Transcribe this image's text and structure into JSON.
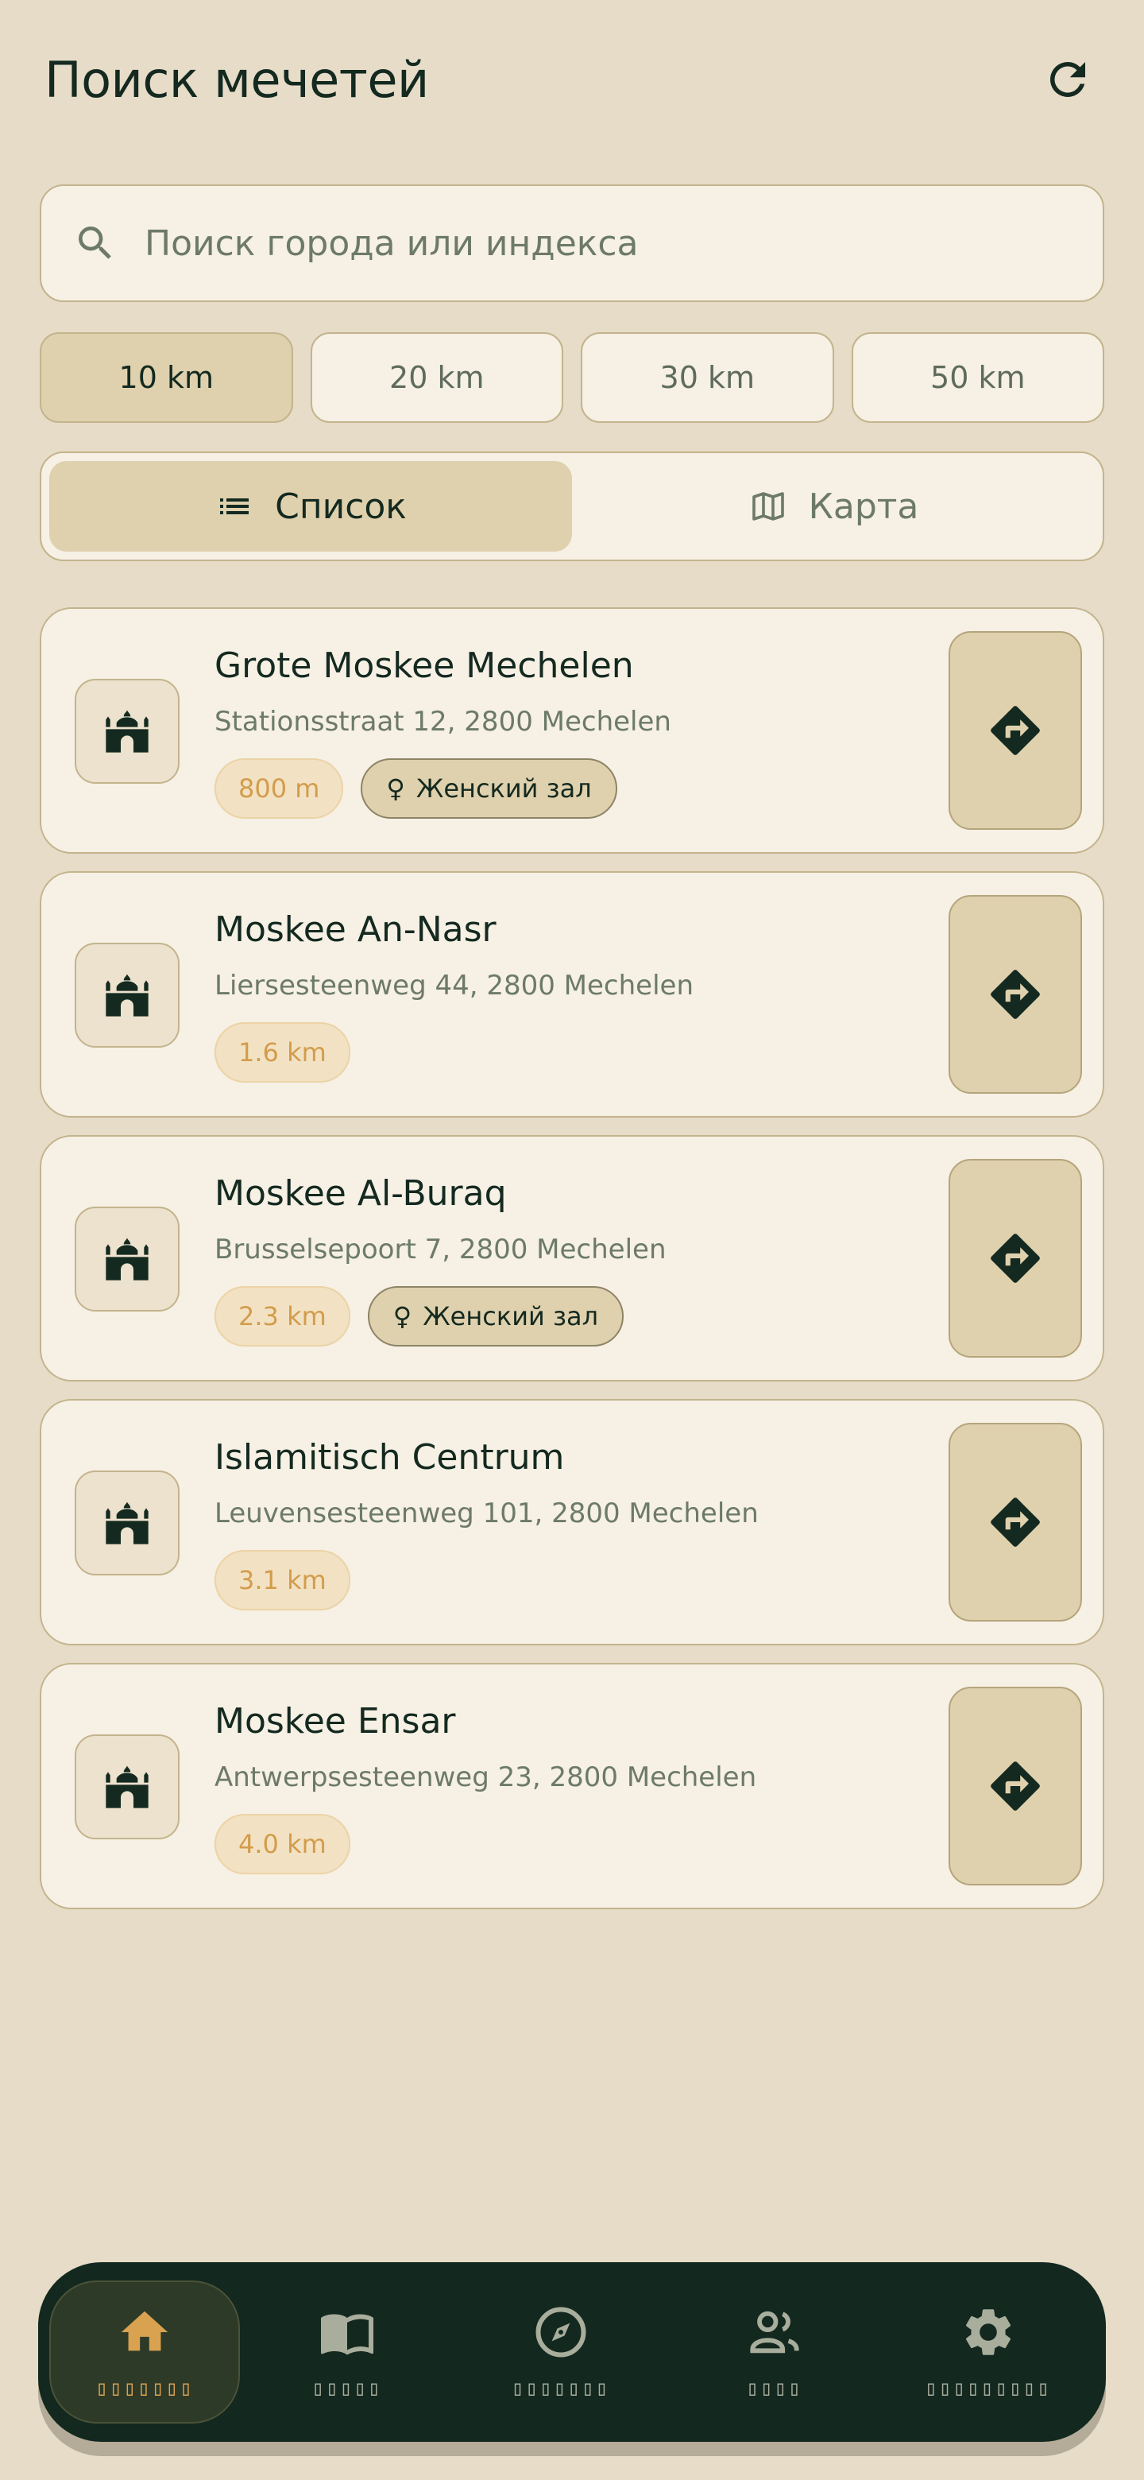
{
  "header": {
    "title": "Поиск мечетей"
  },
  "search": {
    "placeholder": "Поиск города или индекса"
  },
  "radius": [
    {
      "label": "10 km",
      "active": true
    },
    {
      "label": "20 km",
      "active": false
    },
    {
      "label": "30 km",
      "active": false
    },
    {
      "label": "50 km",
      "active": false
    }
  ],
  "view_toggle": {
    "list_label": "Список",
    "map_label": "Карта",
    "selected": "list"
  },
  "mosques": [
    {
      "name": "Grote Moskee Mechelen",
      "address": "Stationsstraat 12, 2800 Mechelen",
      "distance": "800 m",
      "women": "Женский зал"
    },
    {
      "name": "Moskee An-Nasr",
      "address": "Liersesteenweg 44, 2800 Mechelen",
      "distance": "1.6 km",
      "women": null
    },
    {
      "name": "Moskee Al-Buraq",
      "address": "Brusselsepoort 7, 2800 Mechelen",
      "distance": "2.3 km",
      "women": "Женский зал"
    },
    {
      "name": "Islamitisch Centrum",
      "address": "Leuvensesteenweg 101, 2800 Mechelen",
      "distance": "3.1 km",
      "women": null
    },
    {
      "name": "Moskee Ensar",
      "address": "Antwerpsesteenweg 23, 2800 Mechelen",
      "distance": "4.0 km",
      "women": null
    }
  ],
  "nav": {
    "items": [
      {
        "icon": "home-icon",
        "label": "▯▯▯▯▯▯▯",
        "active": true
      },
      {
        "icon": "book-icon",
        "label": "▯▯▯▯▯",
        "active": false
      },
      {
        "icon": "compass-icon",
        "label": "▯▯▯▯▯▯▯",
        "active": false
      },
      {
        "icon": "people-icon",
        "label": "▯▯▯▯",
        "active": false
      },
      {
        "icon": "gear-icon",
        "label": "▯▯▯▯▯▯▯▯▯",
        "active": false
      }
    ]
  },
  "colors": {
    "background": "#e6dcc8",
    "card": "#f6f0e5",
    "accent": "#d9a250",
    "dark": "#13281f",
    "chip_active": "#dfd1ae"
  }
}
